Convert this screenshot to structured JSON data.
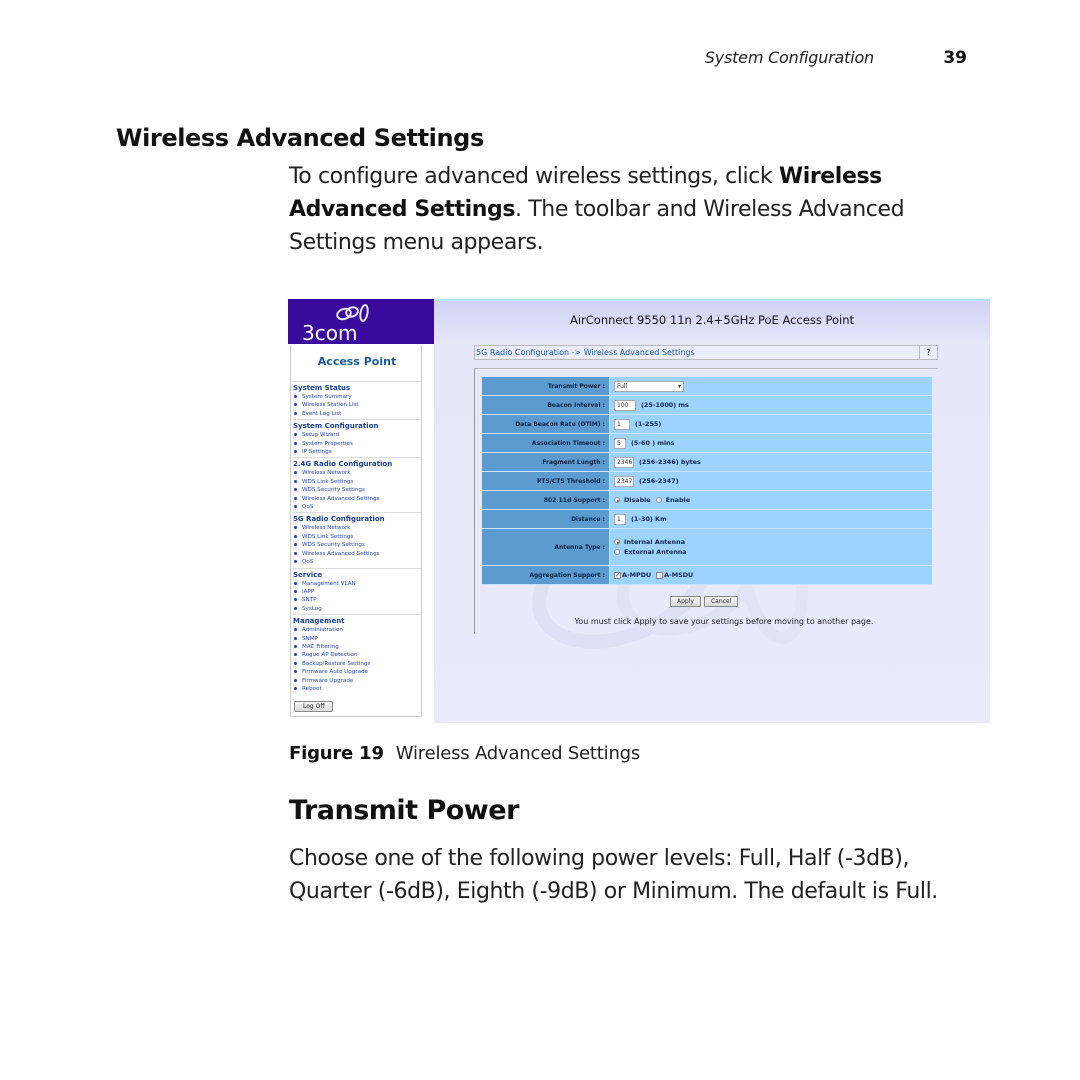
{
  "running_head": {
    "title": "System Configuration",
    "page_number": "39"
  },
  "section": {
    "heading": "Wireless Advanced Settings",
    "intro": {
      "part1": "To configure advanced wireless settings, click ",
      "bold": "Wireless Advanced Settings",
      "part2": ". The toolbar and Wireless Advanced Settings menu appears."
    }
  },
  "figure": {
    "sidebar": {
      "brand": "3com",
      "title": "Access Point",
      "groups": [
        {
          "title": "System Status",
          "items": [
            "System Summary",
            "Wireless Station List",
            "Event Log List"
          ]
        },
        {
          "title": "System Configuration",
          "items": [
            "Setup Wizard",
            "System Properties",
            "IP Settings"
          ]
        },
        {
          "title": "2.4G Radio Configuration",
          "items": [
            "Wireless Network",
            "WDS Link Settings",
            "WDS Security Settings",
            "Wireless Advanced Settings",
            "QoS"
          ]
        },
        {
          "title": "5G Radio Configuration",
          "items": [
            "Wireless Network",
            "WDS Link Settings",
            "WDS Security Settings",
            "Wireless Advanced Settings",
            "QoS"
          ]
        },
        {
          "title": "Service",
          "items": [
            "Management VLAN",
            "IAPP",
            "SNTP",
            "SysLog"
          ]
        },
        {
          "title": "Management",
          "items": [
            "Administration",
            "SNMP",
            "MAC Filtering",
            "Rogue AP Detection",
            "Backup/Restore Settings",
            "Firmware Auto Upgrade",
            "Firmware Upgrade",
            "Reboot"
          ]
        }
      ],
      "logoff_label": "Log Off"
    },
    "main": {
      "app_title": "AirConnect 9550 11n 2.4+5GHz PoE Access Point",
      "breadcrumb": "5G Radio Configuration -> Wireless Advanced Settings",
      "help_label": "?",
      "form": {
        "transmit_power": {
          "label": "Transmit Power :",
          "value": "Full"
        },
        "beacon_interval": {
          "label": "Beacon Interval :",
          "value": "100",
          "hint": "(25-1000) ms"
        },
        "dtim": {
          "label": "Data Beacon Rate (DTIM) :",
          "value": "1",
          "hint": "(1-255)"
        },
        "association_timeout": {
          "label": "Association Timeout :",
          "value": "5",
          "hint": "(5-60 ) mins"
        },
        "fragment_length": {
          "label": "Fragment Length :",
          "value": "2346",
          "hint": "(256-2346) bytes"
        },
        "rts_threshold": {
          "label": "RTS/CTS Threshold :",
          "value": "2347",
          "hint": "(256-2347)"
        },
        "dot11d": {
          "label": "802.11d Support :",
          "options": [
            "Disable",
            "Enable"
          ],
          "selected": "Disable"
        },
        "distance": {
          "label": "Distance :",
          "value": "1",
          "hint": "(1-30) Km"
        },
        "antenna_type": {
          "label": "Antenna Type :",
          "options": [
            "Internal Antenna",
            "External Antenna"
          ],
          "selected": "Internal Antenna"
        },
        "aggregation": {
          "label": "Aggregation Support :",
          "options": [
            "A-MPDU",
            "A-MSDU"
          ],
          "checked": [
            "A-MPDU"
          ]
        }
      },
      "apply_label": "Apply",
      "cancel_label": "Cancel",
      "notice": "You must click Apply to save your settings before moving to another page."
    },
    "caption": {
      "label": "Figure 19",
      "text": "Wireless Advanced Settings"
    }
  },
  "transmit_power_section": {
    "heading": "Transmit Power",
    "body": "Choose one of the following power levels: Full, Half (-3dB), Quarter (-6dB), Eighth (-9dB) or Minimum. The default is Full."
  }
}
